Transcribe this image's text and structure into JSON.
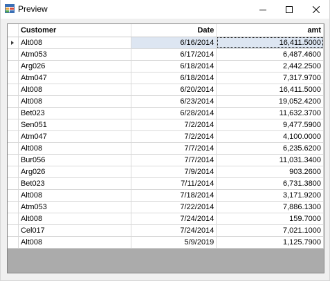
{
  "window": {
    "title": "Preview",
    "icon": "grid-app-icon"
  },
  "grid": {
    "columns": [
      {
        "key": "customer",
        "label": "Customer",
        "align": "left"
      },
      {
        "key": "date",
        "label": "Date",
        "align": "right"
      },
      {
        "key": "amt",
        "label": "amt",
        "align": "right"
      }
    ],
    "selected_row": 0,
    "rows": [
      {
        "customer": "Alt008",
        "date": "6/16/2014",
        "amt": "16,411.5000"
      },
      {
        "customer": "Atm053",
        "date": "6/17/2014",
        "amt": "6,487.4600"
      },
      {
        "customer": "Arg026",
        "date": "6/18/2014",
        "amt": "2,442.2500"
      },
      {
        "customer": "Atm047",
        "date": "6/18/2014",
        "amt": "7,317.9700"
      },
      {
        "customer": "Alt008",
        "date": "6/20/2014",
        "amt": "16,411.5000"
      },
      {
        "customer": "Alt008",
        "date": "6/23/2014",
        "amt": "19,052.4200"
      },
      {
        "customer": "Bet023",
        "date": "6/28/2014",
        "amt": "11,632.3700"
      },
      {
        "customer": "Sen051",
        "date": "7/2/2014",
        "amt": "9,477.5900"
      },
      {
        "customer": "Atm047",
        "date": "7/2/2014",
        "amt": "4,100.0000"
      },
      {
        "customer": "Alt008",
        "date": "7/7/2014",
        "amt": "6,235.6200"
      },
      {
        "customer": "Bur056",
        "date": "7/7/2014",
        "amt": "11,031.3400"
      },
      {
        "customer": "Arg026",
        "date": "7/9/2014",
        "amt": "903.2600"
      },
      {
        "customer": "Bet023",
        "date": "7/11/2014",
        "amt": "6,731.3800"
      },
      {
        "customer": "Alt008",
        "date": "7/18/2014",
        "amt": "3,171.9200"
      },
      {
        "customer": "Atm053",
        "date": "7/22/2014",
        "amt": "7,886.1300"
      },
      {
        "customer": "Alt008",
        "date": "7/24/2014",
        "amt": "159.7000"
      },
      {
        "customer": "Cel017",
        "date": "7/24/2014",
        "amt": "7,021.1000"
      },
      {
        "customer": "Alt008",
        "date": "5/9/2019",
        "amt": "1,125.7900"
      }
    ]
  },
  "colors": {
    "selection": "#dde6f2",
    "grid_background": "#ababab",
    "gridline": "#d8d8d8"
  }
}
